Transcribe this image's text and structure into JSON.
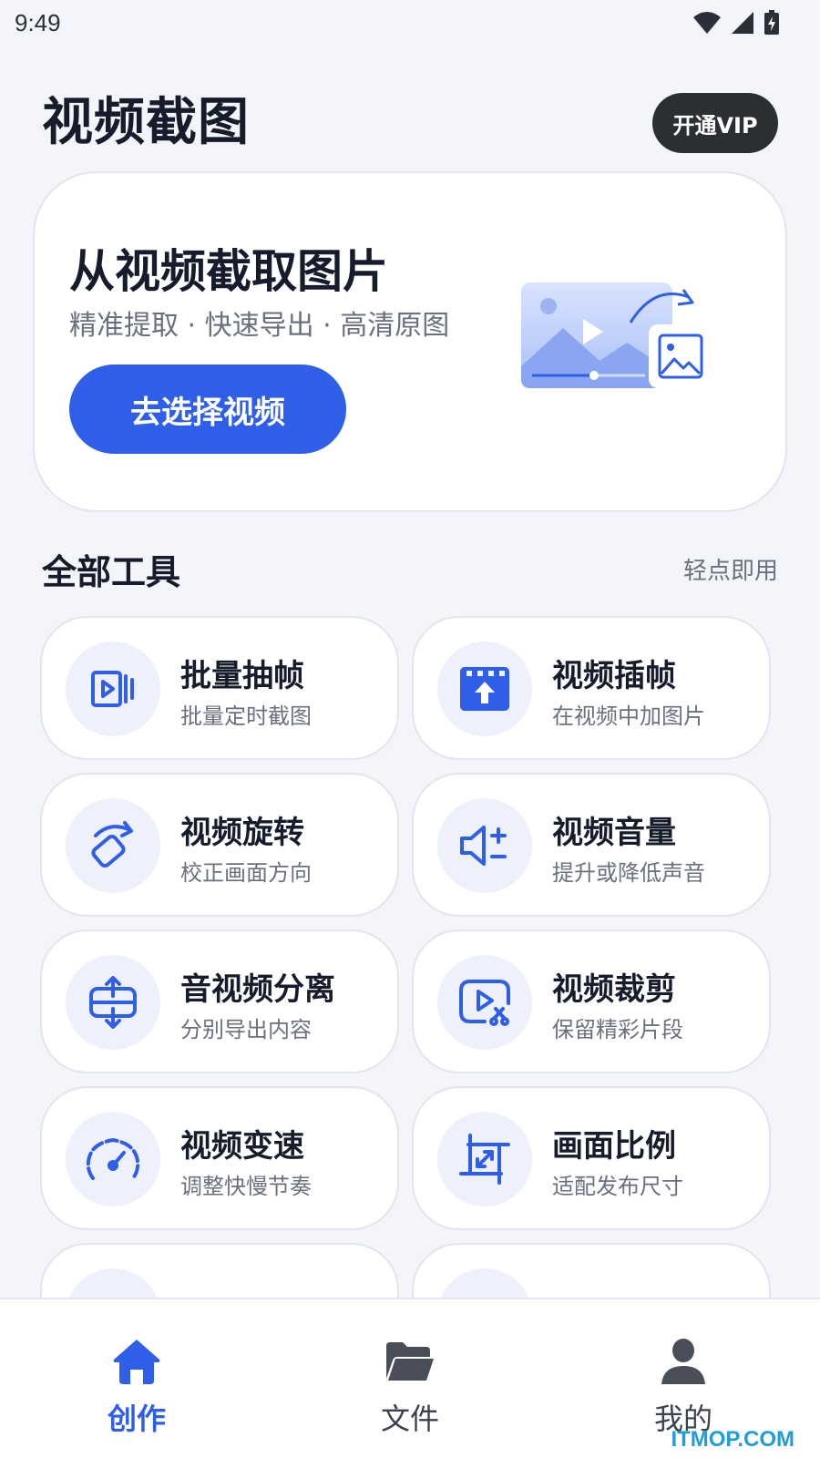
{
  "status_bar": {
    "time": "9:49"
  },
  "header": {
    "title": "视频截图",
    "vip_label": "开通VIP"
  },
  "hero": {
    "title": "从视频截取图片",
    "subtitle": "精准提取 · 快速导出 · 高清原图",
    "button_label": "去选择视频"
  },
  "tools_section": {
    "title": "全部工具",
    "hint": "轻点即用"
  },
  "tools": [
    {
      "title": "批量抽帧",
      "subtitle": "批量定时截图",
      "icon": "frame-extract-icon"
    },
    {
      "title": "视频插帧",
      "subtitle": "在视频中加图片",
      "icon": "frame-insert-icon"
    },
    {
      "title": "视频旋转",
      "subtitle": "校正画面方向",
      "icon": "rotate-icon"
    },
    {
      "title": "视频音量",
      "subtitle": "提升或降低声音",
      "icon": "volume-icon"
    },
    {
      "title": "音视频分离",
      "subtitle": "分别导出内容",
      "icon": "split-icon"
    },
    {
      "title": "视频裁剪",
      "subtitle": "保留精彩片段",
      "icon": "video-cut-icon"
    },
    {
      "title": "视频变速",
      "subtitle": "调整快慢节奏",
      "icon": "speed-icon"
    },
    {
      "title": "画面比例",
      "subtitle": "适配发布尺寸",
      "icon": "aspect-ratio-icon"
    }
  ],
  "bottom_nav": [
    {
      "label": "创作",
      "icon": "home-icon",
      "active": true
    },
    {
      "label": "文件",
      "icon": "folder-icon",
      "active": false
    },
    {
      "label": "我的",
      "icon": "user-icon",
      "active": false
    }
  ],
  "watermark": "ITMOP.COM",
  "colors": {
    "accent": "#2f5ee8",
    "background": "#f4f5fa",
    "icon_bg": "#eef1fb",
    "dark_button": "#2b2e33"
  }
}
